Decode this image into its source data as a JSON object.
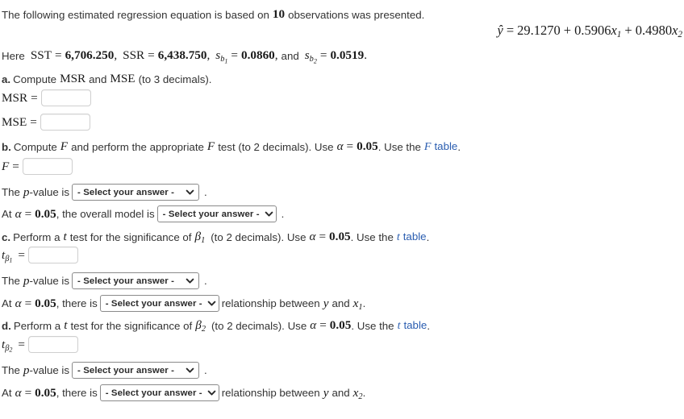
{
  "intro": {
    "before": "The following estimated regression equation is based on",
    "observations": "10",
    "after": "observations was presented."
  },
  "equation": {
    "lhs": "ŷ",
    "eq": "=",
    "intercept": "29.1270",
    "plus1": "+",
    "coef1": "0.5906",
    "var1": "x",
    "var1_sub": "1",
    "plus2": "+",
    "coef2": "0.4980",
    "var2": "x",
    "var2_sub": "2"
  },
  "given": {
    "here": "Here",
    "sst_label": "SST",
    "sst_value": "6,706.250",
    "ssr_label": "SSR",
    "ssr_value": "6,438.750",
    "sb1_label": "s",
    "sb1_sub": "b",
    "sb1_sub_sub": "1",
    "sb1_value": "0.0860",
    "and": "and",
    "sb2_label": "s",
    "sb2_sub": "b",
    "sb2_sub_sub": "2",
    "sb2_value": "0.0519",
    "eq": "=",
    "comma": ",",
    "period": "."
  },
  "parts": {
    "a": {
      "label": "a.",
      "prompt_1": "Compute",
      "msr": "MSR",
      "and": "and",
      "mse": "MSE",
      "prompt_2": "(to 3 decimals).",
      "msr_row_label": "MSR",
      "msr_eq": "=",
      "msr_value": "",
      "msr_placeholder": "",
      "mse_row_label": "MSE",
      "mse_eq": "=",
      "mse_value": "",
      "mse_placeholder": ""
    },
    "b": {
      "label": "b.",
      "prompt_1": "Compute",
      "f1": "F",
      "prompt_2": "and perform the appropriate",
      "f2": "F",
      "prompt_3": "test (to 2 decimals). Use",
      "alpha": "α",
      "alpha_eq": "=",
      "alpha_value": "0.05",
      "prompt_4": ". Use the",
      "table_link_italic": "F",
      "table_link_text": "table",
      "period": ".",
      "f_row_label": "F",
      "f_eq": "=",
      "f_value": "",
      "f_placeholder": "",
      "pvalue_pre": "The",
      "pvalue_p": "p",
      "pvalue_post": "-value is",
      "pvalue_select": "- Select your answer -",
      "pvalue_period": ".",
      "alpha_pre": "At",
      "alpha_sym": "α",
      "alpha_mid": ", the overall model is",
      "model_select": "- Select your answer -",
      "alpha_period": "."
    },
    "c": {
      "label": "c.",
      "prompt_1": "Perform a",
      "t": "t",
      "prompt_2": "test for the significance of",
      "beta": "β",
      "beta_sub": "1",
      "prompt_3": "(to 2 decimals). Use",
      "alpha": "α",
      "alpha_eq": "=",
      "alpha_value": "0.05",
      "prompt_4": ". Use the",
      "table_link_italic": "t",
      "table_link_text": "table",
      "period": ".",
      "t_row_label": "t",
      "t_row_sub_beta": "β",
      "t_row_sub_num": "1",
      "t_eq": "=",
      "t_value": "",
      "t_placeholder": "",
      "pvalue_pre": "The",
      "pvalue_p": "p",
      "pvalue_post": "-value is",
      "pvalue_select": "- Select your answer -",
      "pvalue_period": ".",
      "alpha_pre": "At",
      "alpha_sym": "α",
      "alpha_mid": ", there is",
      "rel_select": "- Select your answer -",
      "rel_text_1": "relationship between",
      "rel_y": "y",
      "rel_and": "and",
      "rel_x": "x",
      "rel_x_sub": "1",
      "alpha_period": "."
    },
    "d": {
      "label": "d.",
      "prompt_1": "Perform a",
      "t": "t",
      "prompt_2": "test for the significance of",
      "beta": "β",
      "beta_sub": "2",
      "prompt_3": "(to 2 decimals). Use",
      "alpha": "α",
      "alpha_eq": "=",
      "alpha_value": "0.05",
      "prompt_4": ". Use the",
      "table_link_italic": "t",
      "table_link_text": "table",
      "period": ".",
      "t_row_label": "t",
      "t_row_sub_beta": "β",
      "t_row_sub_num": "2",
      "t_eq": "=",
      "t_value": "",
      "t_placeholder": "",
      "pvalue_pre": "The",
      "pvalue_p": "p",
      "pvalue_post": "-value is",
      "pvalue_select": "- Select your answer -",
      "pvalue_period": ".",
      "alpha_pre": "At",
      "alpha_sym": "α",
      "alpha_mid": ", there is",
      "rel_select": "- Select your answer -",
      "rel_text_1": "relationship between",
      "rel_y": "y",
      "rel_and": "and",
      "rel_x": "x",
      "rel_x_sub": "2",
      "alpha_period": "."
    }
  },
  "colors": {
    "link": "#2a5db0",
    "text": "#333333",
    "math": "#1a1a1a",
    "input_border": "#cfcfcf",
    "select_border": "#8a8a8a"
  },
  "icons": {
    "chevron": "chevron-down-icon"
  }
}
